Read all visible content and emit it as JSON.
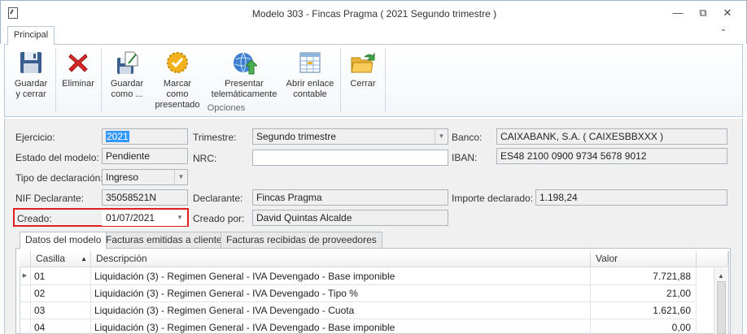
{
  "window": {
    "title": "Modelo 303 - Fincas Pragma ( 2021 Segundo trimestre )",
    "controls": {
      "minimize": "—",
      "restore": "⧉",
      "close": "✕"
    }
  },
  "ribbon": {
    "tab": "Principal",
    "collapse": "⌃",
    "buttons": {
      "save_close": "Guardar\ny cerrar",
      "delete": "Eliminar",
      "save_as": "Guardar\ncomo ...",
      "mark_presented": "Marcar como\npresentado",
      "present_telematic": "Presentar\ntelemáticamente",
      "open_link": "Abrir enlace\ncontable",
      "close": "Cerrar"
    },
    "group_label": "Opciones"
  },
  "form": {
    "ejercicio": {
      "label": "Ejercicio:",
      "value": "2021"
    },
    "trimestre": {
      "label": "Trimestre:",
      "value": "Segundo trimestre"
    },
    "banco": {
      "label": "Banco:",
      "value": "CAIXABANK, S.A. ( CAIXESBBXXX )"
    },
    "estado": {
      "label": "Estado del modelo:",
      "value": "Pendiente"
    },
    "nrc": {
      "label": "NRC:",
      "value": ""
    },
    "iban": {
      "label": "IBAN:",
      "value": "ES48 2100 0900 9734 5678 9012"
    },
    "tipo": {
      "label": "Tipo de declaración:",
      "value": "Ingreso"
    },
    "nif": {
      "label": "NIF Declarante:",
      "value": "35058521N"
    },
    "declarante": {
      "label": "Declarante:",
      "value": "Fincas Pragma"
    },
    "importe": {
      "label": "Importe declarado:",
      "value": "1.198,24"
    },
    "creado": {
      "label": "Creado:",
      "value": "01/07/2021"
    },
    "creado_por": {
      "label": "Creado por:",
      "value": "David Quintas Alcalde"
    }
  },
  "tabs": [
    "Datos del modelo",
    "Facturas emitidas a clientes",
    "Facturas recibidas de proveedores"
  ],
  "grid": {
    "headers": {
      "casilla": "Casilla",
      "descripcion": "Descripción",
      "valor": "Valor",
      "sort": "▲"
    },
    "rows": [
      {
        "casilla": "01",
        "descripcion": "Liquidación (3) - Regimen General - IVA Devengado - Base imponible",
        "valor": "7.721,88"
      },
      {
        "casilla": "02",
        "descripcion": "Liquidación (3) - Regimen General - IVA Devengado - Tipo %",
        "valor": "21,00"
      },
      {
        "casilla": "03",
        "descripcion": "Liquidación (3) - Regimen General - IVA Devengado - Cuota",
        "valor": "1.621,60"
      },
      {
        "casilla": "04",
        "descripcion": "Liquidación (3) - Regimen General - IVA Devengado - Base imponible",
        "valor": "0,00"
      }
    ]
  }
}
